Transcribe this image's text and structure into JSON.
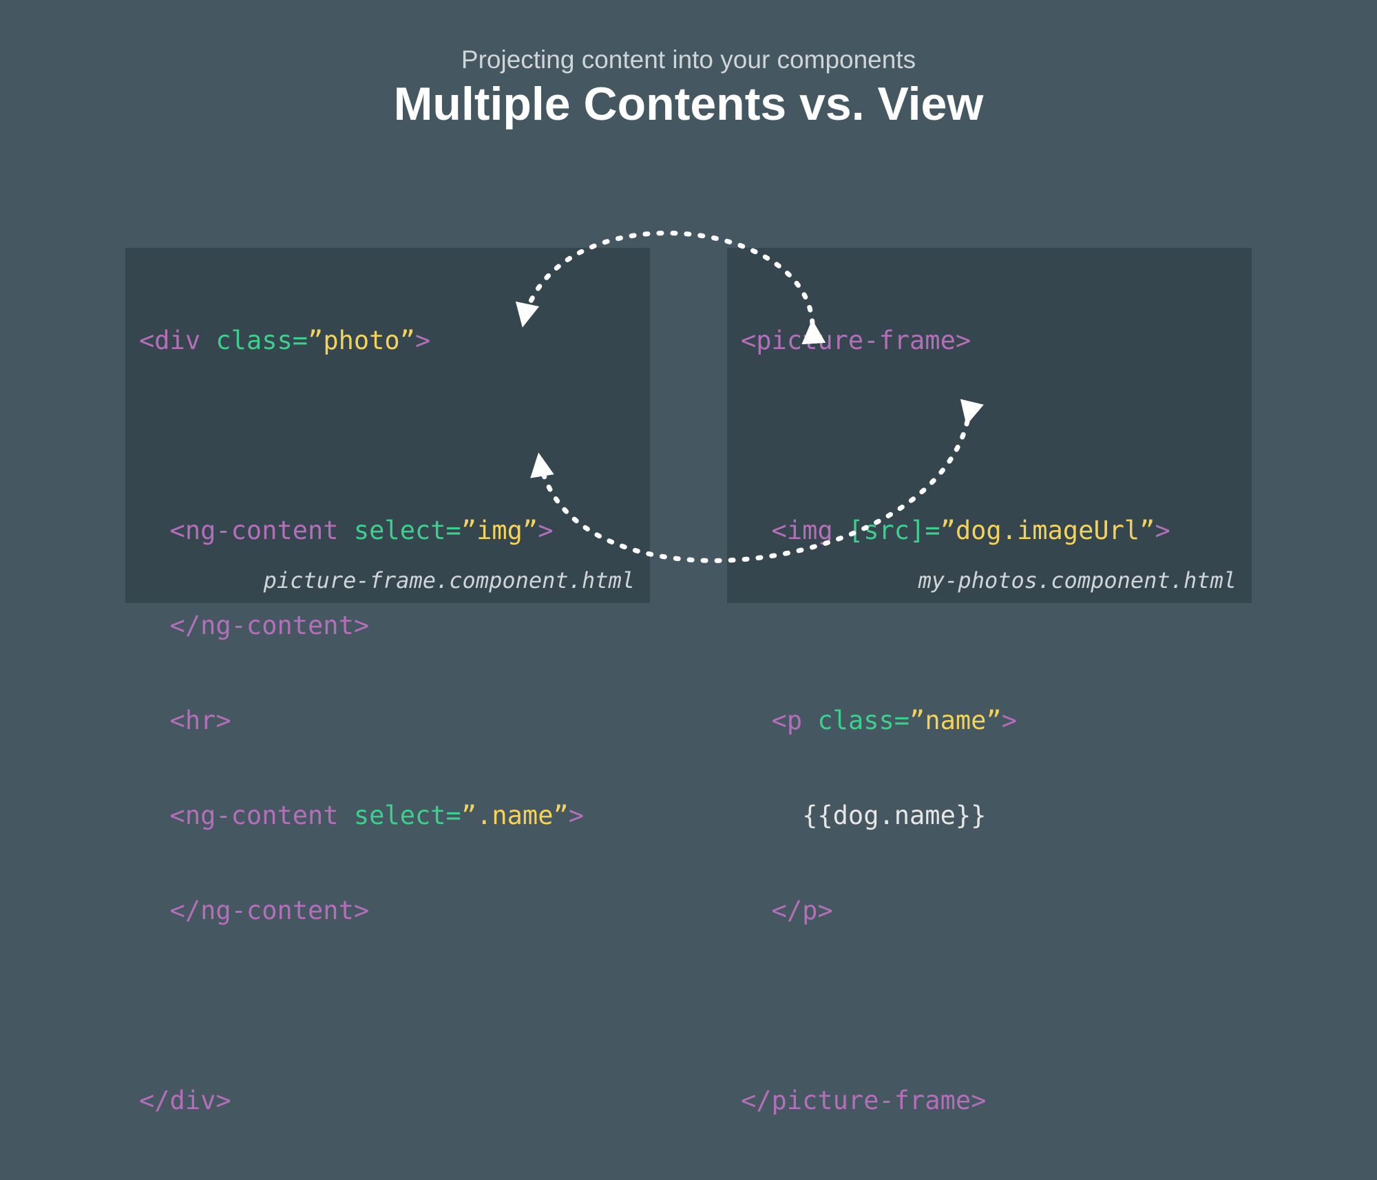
{
  "header": {
    "subtitle": "Projecting content into your components",
    "title": "Multiple Contents vs. View"
  },
  "left_panel": {
    "lines": {
      "l1": {
        "t1": "<div ",
        "a1": "class=",
        "v1": "”photo”",
        "t2": ">"
      },
      "l3": {
        "t1": "  <ng-content ",
        "a1": "select=",
        "v1": "”img”",
        "t2": ">"
      },
      "l4": {
        "t1": "  </ng-content>"
      },
      "l5": {
        "t1": "  <hr>"
      },
      "l6": {
        "t1": "  <ng-content ",
        "a1": "select=",
        "v1": "”.name”",
        "t2": ">"
      },
      "l7": {
        "t1": "  </ng-content>"
      },
      "l9": {
        "t1": "</div>"
      }
    },
    "filename": "picture-frame.component.html"
  },
  "right_panel": {
    "lines": {
      "l1": {
        "t1": "<picture-frame>"
      },
      "l3": {
        "t1": "  <img ",
        "a1": "[src]=",
        "v1": "”dog.imageUrl”",
        "t2": ">"
      },
      "l5": {
        "t1": "  <p ",
        "a1": "class=",
        "v1": "”name”",
        "t2": ">"
      },
      "l6": {
        "p1": "    {{dog.name}}"
      },
      "l7": {
        "t1": "  </p>"
      },
      "l9": {
        "t1": "</picture-frame>"
      }
    },
    "filename": "my-photos.component.html"
  },
  "colors": {
    "background": "#455760",
    "panel": "#35464f",
    "tag": "#b36fb8",
    "attribute": "#3ecf8e",
    "string": "#f3d35c",
    "arrow": "#ffffff"
  }
}
